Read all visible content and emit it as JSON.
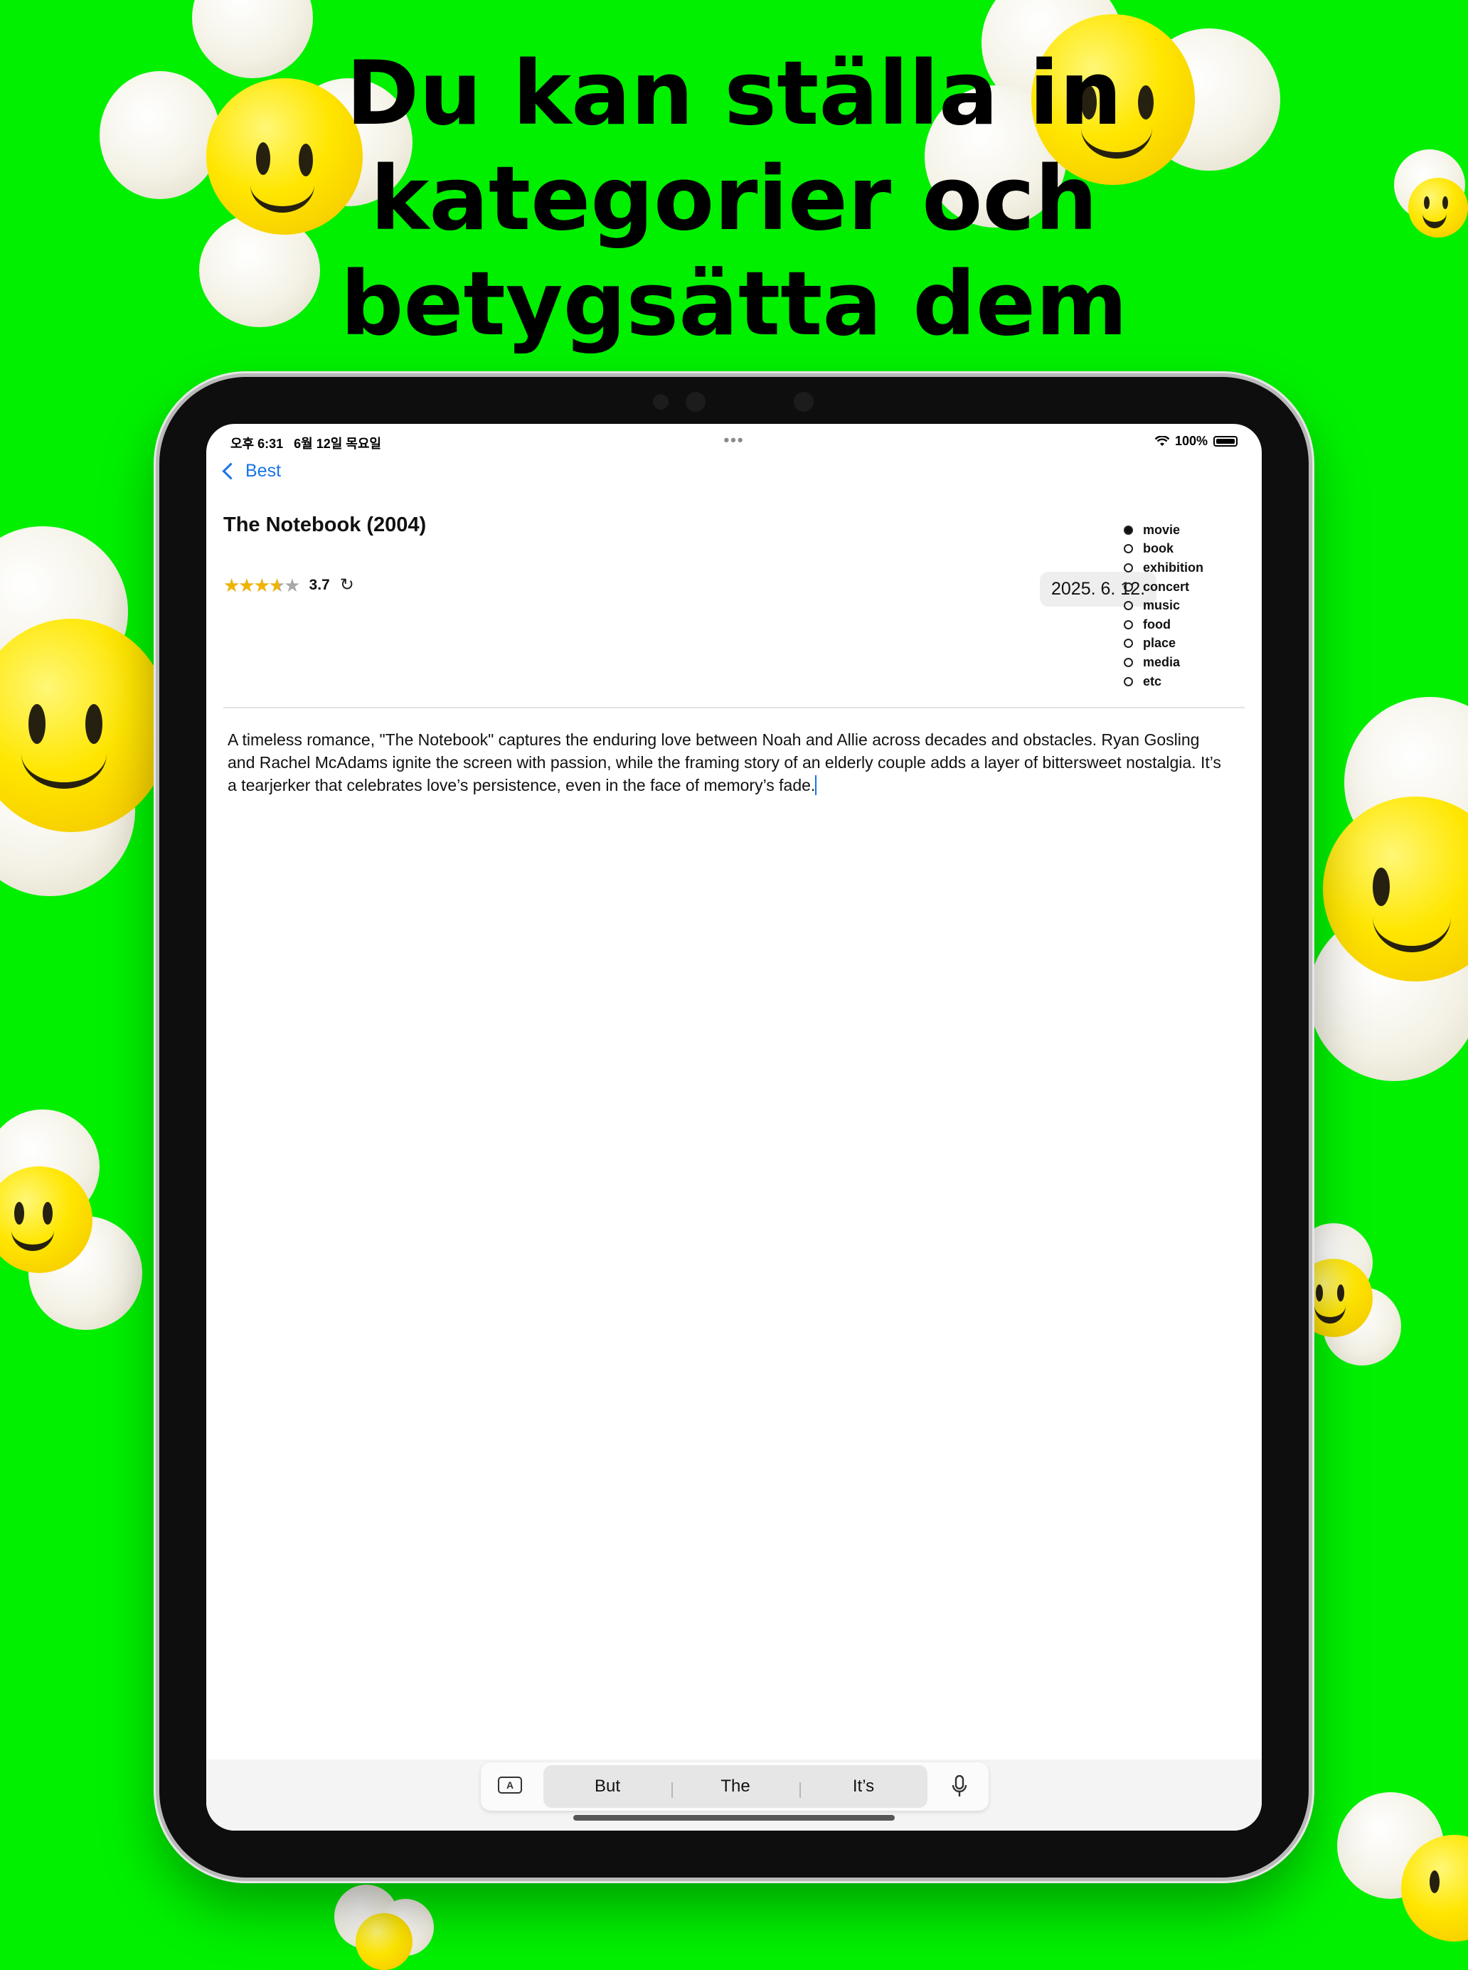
{
  "headline": {
    "line1": "Du kan ställa in",
    "line2": "kategorier och",
    "line3": "betygsätta dem"
  },
  "status_bar": {
    "time_date": "오후 6:31   6월 12일 목요일",
    "dots": "•••",
    "battery": "100%"
  },
  "nav": {
    "back_label": "Best"
  },
  "entry": {
    "title": "The Notebook (2004)",
    "rating": "3.7",
    "rating_fraction": 0.74,
    "date": "2025. 6. 12."
  },
  "categories": [
    {
      "label": "movie",
      "selected": true
    },
    {
      "label": "book",
      "selected": false
    },
    {
      "label": "exhibition",
      "selected": false
    },
    {
      "label": "concert",
      "selected": false
    },
    {
      "label": "music",
      "selected": false
    },
    {
      "label": "food",
      "selected": false
    },
    {
      "label": "place",
      "selected": false
    },
    {
      "label": "media",
      "selected": false
    },
    {
      "label": "etc",
      "selected": false
    }
  ],
  "review_text": "A timeless romance, \"The Notebook\" captures the enduring love between Noah and Allie across decades and obstacles. Ryan Gosling and Rachel McAdams ignite the screen with passion, while the framing story of an elderly couple adds a layer of bittersweet nostalgia. It’s a tearjerker that celebrates love’s persistence, even in the face of memory’s fade.",
  "keyboard": {
    "format_icon": "A",
    "suggestions": [
      "But",
      "The",
      "It’s"
    ]
  },
  "colors": {
    "background": "#00f000",
    "accent": "#1a73e8",
    "star": "#f0b400"
  }
}
